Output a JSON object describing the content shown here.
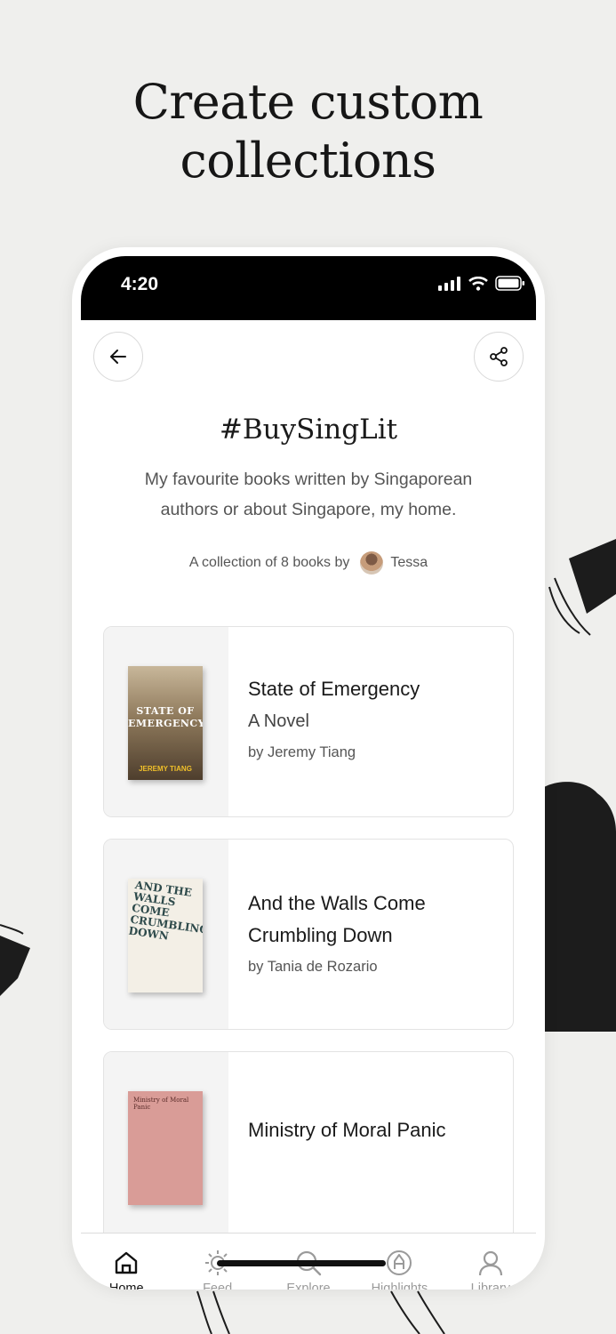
{
  "headline": {
    "line1": "Create custom",
    "line2": "collections"
  },
  "status_bar": {
    "time": "4:20",
    "icons": [
      "signal-icon",
      "wifi-icon",
      "battery-icon"
    ]
  },
  "nav": {
    "back_icon": "arrow-left-icon",
    "share_icon": "share-icon"
  },
  "collection": {
    "title": "#BuySingLit",
    "description": "My favourite books written by Singaporean authors or about Singapore, my home.",
    "byline_prefix": "A collection of 8 books by",
    "curator": "Tessa"
  },
  "books": [
    {
      "title": "State of Emergency",
      "subtitle": "A Novel",
      "author": "by Jeremy Tiang",
      "cover_text": "STATE OF EMERGENCY",
      "cover_author": "JEREMY TIANG"
    },
    {
      "title": "And the Walls Come Crumbling Down",
      "subtitle": "",
      "author": "by Tania de Rozario",
      "cover_text": "AND THE WALLS COME CRUMBLING DOWN"
    },
    {
      "title": "Ministry of Moral Panic",
      "subtitle": "",
      "author": "",
      "cover_text": "Ministry of Moral Panic"
    }
  ],
  "tabs": [
    {
      "label": "Home",
      "icon": "home-icon",
      "active": true
    },
    {
      "label": "Feed",
      "icon": "sun-icon",
      "active": false
    },
    {
      "label": "Explore",
      "icon": "search-icon",
      "active": false
    },
    {
      "label": "Highlights",
      "icon": "highlighter-icon",
      "active": false
    },
    {
      "label": "Library",
      "icon": "person-icon",
      "active": false
    }
  ],
  "colors": {
    "background": "#efefed",
    "accent": "#111111",
    "tab_inactive": "#9a9a9a"
  }
}
